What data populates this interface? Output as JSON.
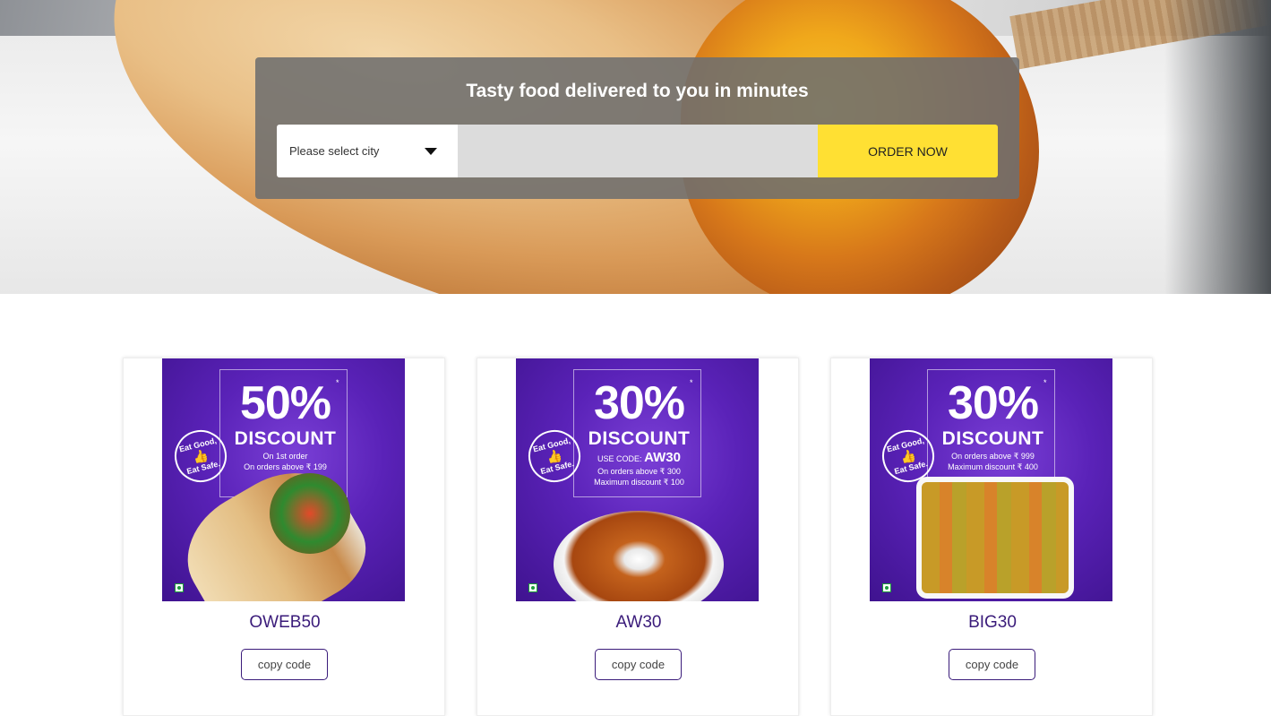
{
  "hero": {
    "title": "Tasty food delivered to you in minutes",
    "city_placeholder": "Please select city",
    "address_value": "",
    "order_label": "ORDER NOW"
  },
  "offers": [
    {
      "percent": "50%",
      "discount_label": "DISCOUNT",
      "lines": [
        "On 1st order",
        "On orders above ₹ 199"
      ],
      "use_code_prefix": "",
      "use_code": "",
      "seal": [
        "Eat Good,",
        "Eat Safe."
      ],
      "food": "wrap",
      "code": "OWEB50",
      "copy_label": "copy code"
    },
    {
      "percent": "30%",
      "discount_label": "DISCOUNT",
      "use_code_prefix": "USE CODE:",
      "use_code": "AW30",
      "lines": [
        "On orders above ₹ 300",
        "Maximum discount ₹ 100"
      ],
      "seal": [
        "Eat Good,",
        "Eat Safe."
      ],
      "food": "curry-bowl",
      "code": "AW30",
      "copy_label": "copy code"
    },
    {
      "percent": "30%",
      "discount_label": "DISCOUNT",
      "lines": [
        "On orders above ₹ 999",
        "Maximum discount ₹ 400"
      ],
      "use_code_prefix": "",
      "use_code": "",
      "seal": [
        "Eat Good,",
        "Eat Safe."
      ],
      "food": "biryani-tray",
      "code": "BIG30",
      "copy_label": "copy code"
    }
  ],
  "colors": {
    "accent": "#ffe033",
    "brand_purple": "#3a1b7a",
    "banner_purple": "#5a22b8"
  }
}
